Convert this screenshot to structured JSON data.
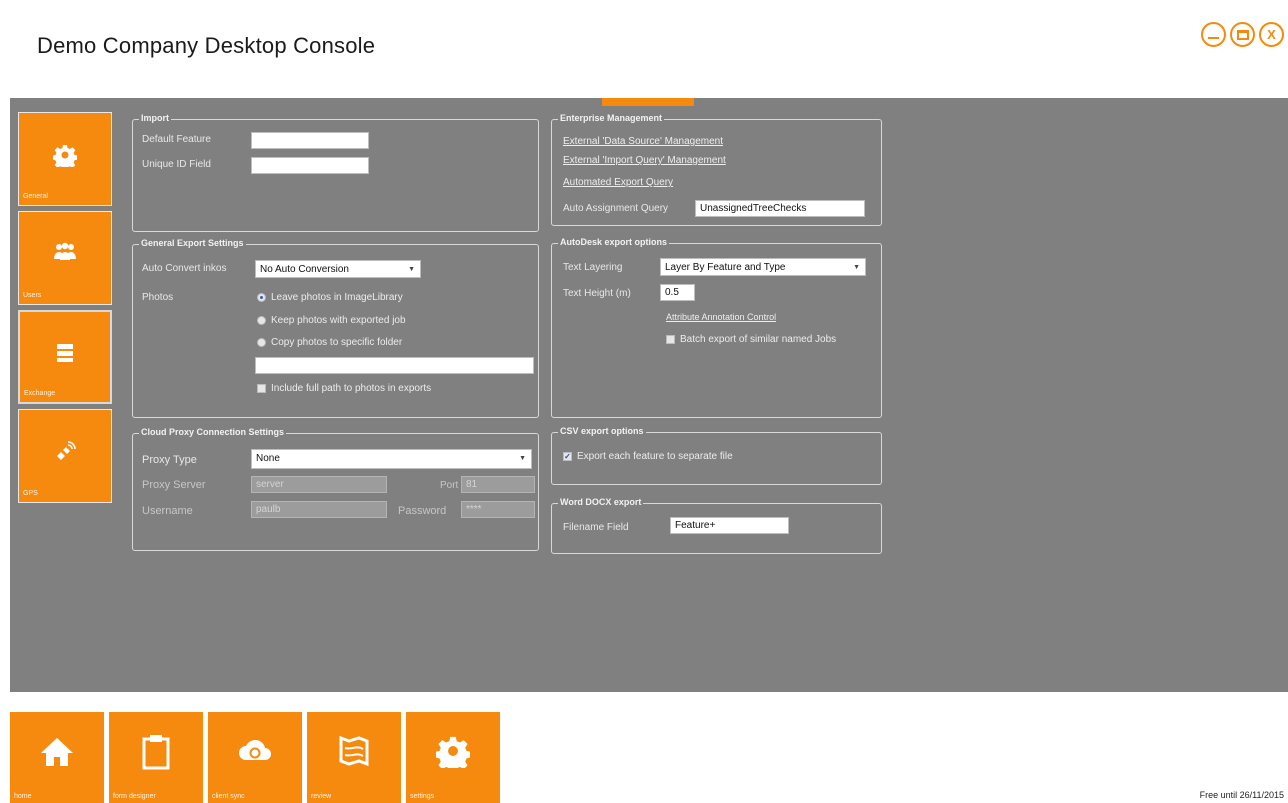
{
  "app": {
    "title": "Demo Company Desktop Console",
    "free_until": "Free until 26/11/2015",
    "accent": "#f58a0f",
    "panel_bg": "#808080"
  },
  "window_controls": {
    "close_glyph": "X",
    "icons": [
      "minimize-icon",
      "restore-icon",
      "close-icon"
    ]
  },
  "sidebar": {
    "items": [
      {
        "label": "General",
        "icon": "gear-icon"
      },
      {
        "label": "Users",
        "icon": "users-icon"
      },
      {
        "label": "Exchange",
        "icon": "exchange-icon"
      },
      {
        "label": "GPS",
        "icon": "satellite-icon"
      }
    ],
    "active_index": 2
  },
  "import": {
    "legend": "Import",
    "default_feature_label": "Default Feature",
    "default_feature_value": "",
    "unique_id_label": "Unique ID Field",
    "unique_id_value": ""
  },
  "general_export": {
    "legend": "General Export Settings",
    "auto_convert_label": "Auto Convert inkos",
    "auto_convert_value": "No Auto Conversion",
    "photos_label": "Photos",
    "photo_options": [
      "Leave photos in ImageLibrary",
      "Keep photos with exported job",
      "Copy photos to specific folder"
    ],
    "folder_value": "",
    "include_full_path_label": "Include full path to photos in exports"
  },
  "proxy": {
    "legend": "Cloud Proxy Connection Settings",
    "type_label": "Proxy Type",
    "type_value": "None",
    "server_label": "Proxy Server",
    "server_value": "server",
    "port_label": "Port",
    "port_value": "81",
    "username_label": "Username",
    "username_value": "paulb",
    "password_label": "Password",
    "password_value": "****"
  },
  "enterprise": {
    "legend": "Enterprise Management",
    "link_data_source": "External 'Data Source' Management",
    "link_import_query": "External 'Import Query' Management",
    "link_export_query": "Automated Export Query",
    "auto_assign_label": "Auto Assignment Query",
    "auto_assign_value": "UnassignedTreeChecks"
  },
  "autodesk": {
    "legend": "AutoDesk export options",
    "text_layering_label": "Text Layering",
    "text_layering_value": "Layer By Feature and Type",
    "text_height_label": "Text Height (m)",
    "text_height_value": "0.5",
    "annotation_link": "Attribute Annotation Control",
    "batch_export_label": "Batch export of similar named Jobs"
  },
  "csv": {
    "legend": "CSV export options",
    "export_each_label": "Export each feature to separate file",
    "export_each_checked": true
  },
  "word": {
    "legend": "Word DOCX export",
    "filename_label": "Filename Field",
    "filename_value": "Feature+"
  },
  "bottom_nav": [
    {
      "label": "home",
      "icon": "home-icon"
    },
    {
      "label": "form designer",
      "icon": "clipboard-icon"
    },
    {
      "label": "client sync",
      "icon": "cloud-sync-icon"
    },
    {
      "label": "review",
      "icon": "map-icon"
    },
    {
      "label": "settings",
      "icon": "gear-icon"
    }
  ]
}
